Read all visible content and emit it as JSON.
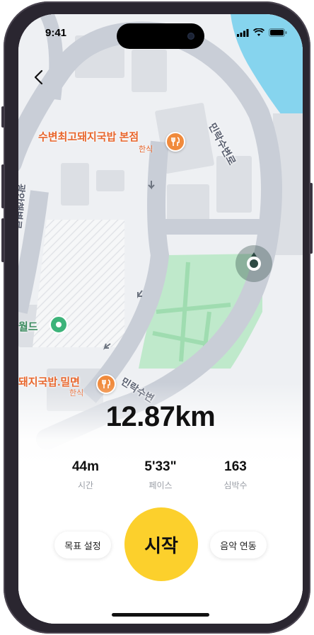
{
  "status_bar": {
    "time": "9:41"
  },
  "map": {
    "pois": [
      {
        "name": "수변최고돼지국밥 본점",
        "category": "한식"
      },
      {
        "name": "돼지국밥.밀면",
        "category": "한식"
      },
      {
        "name": "월드"
      }
    ],
    "roads": [
      {
        "name": "민락수변로"
      },
      {
        "name": "광안해변로"
      },
      {
        "name": "민락수변"
      }
    ]
  },
  "workout": {
    "distance": "12.87km",
    "stats": [
      {
        "value": "44m",
        "label": "시간"
      },
      {
        "value": "5'33\"",
        "label": "페이스"
      },
      {
        "value": "163",
        "label": "심박수"
      }
    ]
  },
  "actions": {
    "goal_label": "목표 설정",
    "start_label": "시작",
    "music_label": "음악 연동"
  },
  "colors": {
    "accent": "#fcd02c",
    "poi_orange": "#f08a3c",
    "park_green": "#bfe9cb",
    "water_blue": "#86d4ee",
    "location_teal": "#2e4a44"
  },
  "icons": [
    "back-arrow-icon",
    "fork-knife-icon",
    "location-pin-icon",
    "current-location-icon",
    "signal-icon",
    "wifi-icon",
    "battery-icon"
  ]
}
